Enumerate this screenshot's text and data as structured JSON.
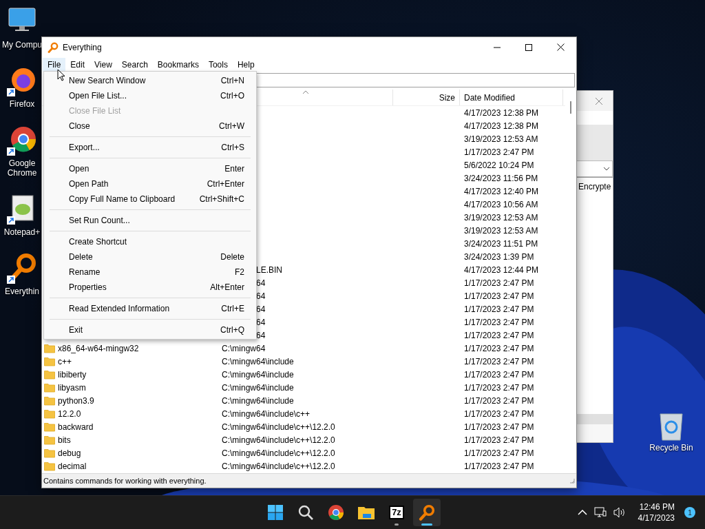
{
  "desktop": {
    "icons": [
      {
        "kind": "computer",
        "label": "My Compu",
        "shortcut": false
      },
      {
        "kind": "firefox",
        "label": "Firefox",
        "shortcut": true
      },
      {
        "kind": "chrome",
        "label": "Google Chrome",
        "shortcut": true
      },
      {
        "kind": "notepad",
        "label": "Notepad+",
        "shortcut": true
      },
      {
        "kind": "everything",
        "label": "Everythin",
        "shortcut": true
      }
    ],
    "recycle_bin": {
      "label": "Recycle Bin"
    }
  },
  "back_window": {
    "field_text": "Encrypte"
  },
  "window": {
    "title": "Everything",
    "menu": [
      {
        "label": "File",
        "selected": true
      },
      {
        "label": "Edit",
        "selected": false
      },
      {
        "label": "View",
        "selected": false
      },
      {
        "label": "Search",
        "selected": false
      },
      {
        "label": "Bookmarks",
        "selected": false
      },
      {
        "label": "Tools",
        "selected": false
      },
      {
        "label": "Help",
        "selected": false
      }
    ],
    "table": {
      "columns": [
        {
          "sorted": true
        },
        {
          "label": "Size",
          "sorted": false
        },
        {
          "label": "Date Modified",
          "sorted": false
        }
      ],
      "rows": [
        {
          "kind": "covered",
          "date_modified": "4/17/2023 12:38 PM"
        },
        {
          "kind": "covered",
          "date_modified": "4/17/2023 12:38 PM"
        },
        {
          "kind": "covered",
          "date_modified": "3/19/2023 12:53 AM"
        },
        {
          "kind": "covered",
          "date_modified": "1/17/2023 2:47 PM"
        },
        {
          "kind": "covered",
          "date_modified": "5/6/2022 10:24 PM"
        },
        {
          "kind": "covered",
          "date_modified": "3/24/2023 11:56 PM"
        },
        {
          "kind": "covered",
          "date_modified": "4/17/2023 12:40 PM"
        },
        {
          "kind": "covered",
          "date_modified": "4/17/2023 10:56 AM"
        },
        {
          "kind": "covered",
          "date_modified": "3/19/2023 12:53 AM"
        },
        {
          "kind": "covered",
          "date_modified": "3/19/2023 12:53 AM"
        },
        {
          "kind": "covered",
          "date_modified": "3/24/2023 11:51 PM"
        },
        {
          "kind": "covered",
          "date_modified": "3/24/2023 1:39 PM"
        },
        {
          "kind": "covered",
          "path": "LE.BIN",
          "date_modified": "4/17/2023 12:44 PM"
        },
        {
          "kind": "covered",
          "path": "64",
          "date_modified": "1/17/2023 2:47 PM"
        },
        {
          "kind": "covered",
          "path": "64",
          "date_modified": "1/17/2023 2:47 PM"
        },
        {
          "kind": "covered",
          "path": "64",
          "date_modified": "1/17/2023 2:47 PM"
        },
        {
          "kind": "covered",
          "path": "64",
          "date_modified": "1/17/2023 2:47 PM"
        },
        {
          "kind": "covered",
          "path": "64",
          "date_modified": "1/17/2023 2:47 PM"
        },
        {
          "kind": "folder",
          "name": "x86_64-w64-mingw32",
          "path": "C:\\mingw64",
          "date_modified": "1/17/2023 2:47 PM"
        },
        {
          "kind": "folder",
          "name": "c++",
          "path": "C:\\mingw64\\include",
          "date_modified": "1/17/2023 2:47 PM"
        },
        {
          "kind": "folder",
          "name": "libiberty",
          "path": "C:\\mingw64\\include",
          "date_modified": "1/17/2023 2:47 PM"
        },
        {
          "kind": "folder",
          "name": "libyasm",
          "path": "C:\\mingw64\\include",
          "date_modified": "1/17/2023 2:47 PM"
        },
        {
          "kind": "folder",
          "name": "python3.9",
          "path": "C:\\mingw64\\include",
          "date_modified": "1/17/2023 2:47 PM"
        },
        {
          "kind": "folder",
          "name": "12.2.0",
          "path": "C:\\mingw64\\include\\c++",
          "date_modified": "1/17/2023 2:47 PM"
        },
        {
          "kind": "folder",
          "name": "backward",
          "path": "C:\\mingw64\\include\\c++\\12.2.0",
          "date_modified": "1/17/2023 2:47 PM"
        },
        {
          "kind": "folder",
          "name": "bits",
          "path": "C:\\mingw64\\include\\c++\\12.2.0",
          "date_modified": "1/17/2023 2:47 PM"
        },
        {
          "kind": "folder",
          "name": "debug",
          "path": "C:\\mingw64\\include\\c++\\12.2.0",
          "date_modified": "1/17/2023 2:47 PM"
        },
        {
          "kind": "folder",
          "name": "decimal",
          "path": "C:\\mingw64\\include\\c++\\12.2.0",
          "date_modified": "1/17/2023 2:47 PM"
        }
      ]
    },
    "status_bar": "Contains commands for working with everything.",
    "file_menu": {
      "items": [
        {
          "kind": "item",
          "label": "New Search Window",
          "shortcut": "Ctrl+N",
          "disabled": false
        },
        {
          "kind": "item",
          "label": "Open File List...",
          "shortcut": "Ctrl+O",
          "disabled": false
        },
        {
          "kind": "item",
          "label": "Close File List",
          "disabled": true
        },
        {
          "kind": "item",
          "label": "Close",
          "shortcut": "Ctrl+W",
          "disabled": false
        },
        {
          "kind": "separator"
        },
        {
          "kind": "item",
          "label": "Export...",
          "shortcut": "Ctrl+S",
          "disabled": false
        },
        {
          "kind": "separator"
        },
        {
          "kind": "item",
          "label": "Open",
          "shortcut": "Enter",
          "disabled": false
        },
        {
          "kind": "item",
          "label": "Open Path",
          "shortcut": "Ctrl+Enter",
          "disabled": false
        },
        {
          "kind": "item",
          "label": "Copy Full Name to Clipboard",
          "shortcut": "Ctrl+Shift+C",
          "disabled": false
        },
        {
          "kind": "separator"
        },
        {
          "kind": "item",
          "label": "Set Run Count...",
          "disabled": false
        },
        {
          "kind": "separator"
        },
        {
          "kind": "item",
          "label": "Create Shortcut",
          "disabled": false
        },
        {
          "kind": "item",
          "label": "Delete",
          "shortcut": "Delete",
          "disabled": false
        },
        {
          "kind": "item",
          "label": "Rename",
          "shortcut": "F2",
          "disabled": false
        },
        {
          "kind": "item",
          "label": "Properties",
          "shortcut": "Alt+Enter",
          "disabled": false
        },
        {
          "kind": "separator"
        },
        {
          "kind": "item",
          "label": "Read Extended Information",
          "shortcut": "Ctrl+E",
          "disabled": false
        },
        {
          "kind": "separator"
        },
        {
          "kind": "item",
          "label": "Exit",
          "shortcut": "Ctrl+Q",
          "disabled": false
        }
      ]
    }
  },
  "taskbar": {
    "apps": [
      {
        "kind": "start",
        "selected": false,
        "running": false
      },
      {
        "kind": "search",
        "selected": false,
        "running": false
      },
      {
        "kind": "chrome",
        "selected": false,
        "running": false
      },
      {
        "kind": "explorer",
        "selected": false,
        "running": false
      },
      {
        "kind": "archiver",
        "label": "7z",
        "selected": false,
        "running": true
      },
      {
        "kind": "everything",
        "selected": true,
        "running": true
      }
    ],
    "clock": {
      "time": "12:46 PM",
      "date": "4/17/2023"
    },
    "notifications": "1"
  }
}
